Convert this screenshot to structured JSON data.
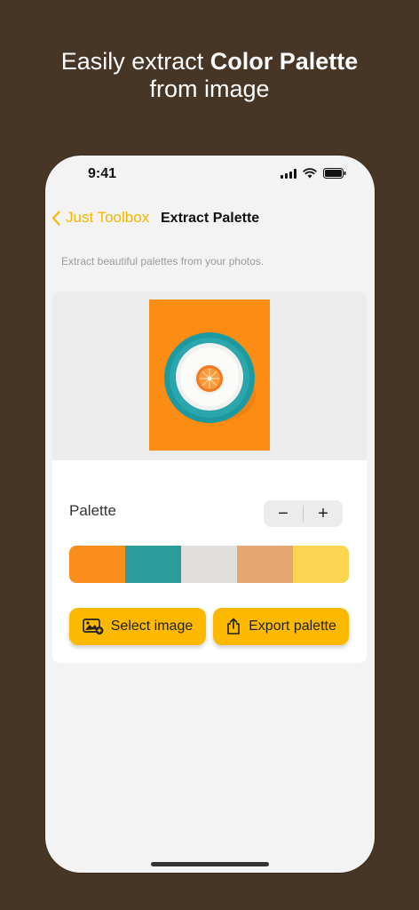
{
  "headline": {
    "prefix": "Easily extract ",
    "bold": "Color Palette",
    "line2": "from image"
  },
  "status_bar": {
    "time": "9:41"
  },
  "nav": {
    "back_label": "Just Toolbox",
    "title": "Extract Palette"
  },
  "subtitle": "Extract beautiful palettes from your photos.",
  "palette": {
    "label": "Palette",
    "stepper_minus": "−",
    "stepper_plus": "+",
    "colors": [
      "#f98e1d",
      "#2b9c9a",
      "#e1dfdb",
      "#e4a771",
      "#fcd552"
    ]
  },
  "actions": {
    "select_image": "Select image",
    "export_palette": "Export palette"
  },
  "icons": {
    "back": "chevron-left-icon",
    "signal": "cellular-signal-icon",
    "wifi": "wifi-icon",
    "battery": "battery-icon",
    "select": "image-add-icon",
    "export": "share-icon"
  },
  "accent_color": "#fcb900"
}
